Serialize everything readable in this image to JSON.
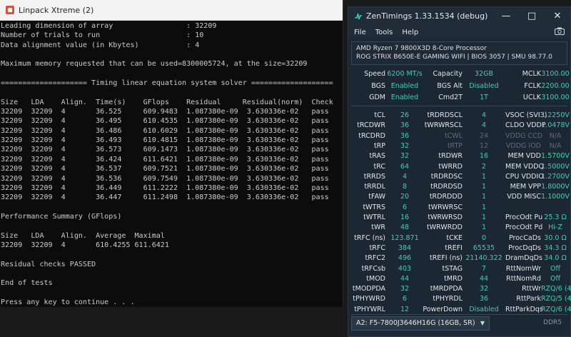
{
  "linpack": {
    "title": "Linpack Xtreme (2)",
    "lines": [
      "Leading dimension of array                 : 32209",
      "Number of trials to run                    : 10",
      "Data alignment value (in Kbytes)           : 4",
      "",
      "Maximum memory requested that can be used=8300005724, at the size=32209",
      "",
      "==================== Timing linear equation system solver ===================",
      "",
      "Size   LDA    Align.  Time(s)    GFlops    Residual     Residual(norm)  Check",
      "32209  32209  4       36.525     609.9483  1.087380e-09  3.630336e-02   pass",
      "32209  32209  4       36.495     610.4535  1.087380e-09  3.630336e-02   pass",
      "32209  32209  4       36.486     610.6029  1.087380e-09  3.630336e-02   pass",
      "32209  32209  4       36.493     610.4815  1.087380e-09  3.630336e-02   pass",
      "32209  32209  4       36.573     609.1473  1.087380e-09  3.630336e-02   pass",
      "32209  32209  4       36.424     611.6421  1.087380e-09  3.630336e-02   pass",
      "32209  32209  4       36.537     609.7521  1.087380e-09  3.630336e-02   pass",
      "32209  32209  4       36.536     609.7549  1.087380e-09  3.630336e-02   pass",
      "32209  32209  4       36.449     611.2222  1.087380e-09  3.630336e-02   pass",
      "32209  32209  4       36.447     611.2498  1.087380e-09  3.630336e-02   pass",
      "",
      "Performance Summary (GFlops)",
      "",
      "Size   LDA    Align.  Average  Maximal",
      "32209  32209  4       610.4255 611.6421",
      "",
      "Residual checks PASSED",
      "",
      "End of tests",
      "",
      "Press any key to continue . . ."
    ]
  },
  "zentimings": {
    "title": "ZenTimings 1.33.1534 (debug)",
    "menu": [
      "File",
      "Tools",
      "Help"
    ],
    "cpu": "AMD Ryzen 7 9800X3D 8-Core Processor",
    "board": "ROG STRIX B650E-E GAMING WIFI | BIOS 3057 | SMU 98.77.0",
    "top_rows": [
      [
        [
          "Speed",
          "6200 MT/s"
        ],
        [
          "Capacity",
          "32GB"
        ],
        [
          "MCLK",
          "3100.00"
        ]
      ],
      [
        [
          "BGS",
          "Enabled"
        ],
        [
          "BGS Alt",
          "Disabled"
        ],
        [
          "FCLK",
          "2200.00"
        ]
      ],
      [
        [
          "GDM",
          "Enabled"
        ],
        [
          "Cmd2T",
          "1T"
        ],
        [
          "UCLK",
          "3100.00"
        ]
      ]
    ],
    "timing_rows": [
      [
        [
          "tCL",
          "26"
        ],
        [
          "tRDRDSCL",
          "4"
        ],
        [
          "VSOC (SVI3)",
          "1.2250V"
        ]
      ],
      [
        [
          "tRCDWR",
          "36"
        ],
        [
          "tWRWRSCL",
          "4"
        ],
        [
          "CLDO VDDP",
          "1.0478V"
        ]
      ],
      [
        [
          "tRCDRD",
          "36"
        ],
        [
          "tCWL",
          "24"
        ],
        [
          "VDDG CCD",
          "N/A"
        ]
      ],
      [
        [
          "tRP",
          "32"
        ],
        [
          "tRTP",
          "12"
        ],
        [
          "VDDG IOD",
          "N/A"
        ]
      ],
      [
        [
          "tRAS",
          "32"
        ],
        [
          "tRDWR",
          "16"
        ],
        [
          "MEM VDD",
          "1.5700V"
        ]
      ],
      [
        [
          "tRC",
          "64"
        ],
        [
          "tWRRD",
          "2"
        ],
        [
          "MEM VDDQ",
          "1.5000V"
        ]
      ],
      [
        [
          "tRRDS",
          "4"
        ],
        [
          "tRDRDSC",
          "1"
        ],
        [
          "CPU VDDIO",
          "1.2700V"
        ]
      ],
      [
        [
          "tRRDL",
          "8"
        ],
        [
          "tRDRDSD",
          "1"
        ],
        [
          "MEM VPP",
          "1.8000V"
        ]
      ],
      [
        [
          "tFAW",
          "20"
        ],
        [
          "tRDRDDD",
          "1"
        ],
        [
          "VDD MISC",
          "1.1000V"
        ]
      ],
      [
        [
          "tWTRS",
          "6"
        ],
        [
          "tWRWRSC",
          "1"
        ],
        [
          "",
          ""
        ]
      ],
      [
        [
          "tWTRL",
          "16"
        ],
        [
          "tWRWRSD",
          "1"
        ],
        [
          "ProcOdt Pu",
          "25.3 Ω"
        ]
      ],
      [
        [
          "tWR",
          "48"
        ],
        [
          "tWRWRDD",
          "1"
        ],
        [
          "ProcOdt Pd",
          "Hi-Z"
        ]
      ],
      [
        [
          "tRFC (ns)",
          "123.871"
        ],
        [
          "tCKE",
          "0"
        ],
        [
          "ProcCaDs",
          "30.0 Ω"
        ]
      ],
      [
        [
          "tRFC",
          "384"
        ],
        [
          "tREFI",
          "65535"
        ],
        [
          "ProcDqDs",
          "34.3 Ω"
        ]
      ],
      [
        [
          "tRFC2",
          "496"
        ],
        [
          "tREFI (ns)",
          "21140.322"
        ],
        [
          "DramDqDs",
          "34.0 Ω"
        ]
      ],
      [
        [
          "tRFCsb",
          "403"
        ],
        [
          "tSTAG",
          "7"
        ],
        [
          "RttNomWr",
          "Off"
        ]
      ],
      [
        [
          "tMOD",
          "44"
        ],
        [
          "tMRD",
          "44"
        ],
        [
          "RttNomRd",
          "Off"
        ]
      ],
      [
        [
          "tMODPDA",
          "32"
        ],
        [
          "tMRDPDA",
          "32"
        ],
        [
          "RttWr",
          "RZQ/6 (40)"
        ]
      ],
      [
        [
          "tPHYWRD",
          "6"
        ],
        [
          "tPHYRDL",
          "36"
        ],
        [
          "RttPark",
          "RZQ/5 (48)"
        ]
      ],
      [
        [
          "tPHYWRL",
          "12"
        ],
        [
          "PowerDown",
          "Disabled"
        ],
        [
          "RttParkDqs",
          "RZQ/6 (40)"
        ]
      ]
    ],
    "dimm_selected": "A2: F5-7800J3646H16G (16GB, SR)",
    "ddr_label": "DDR5",
    "dim_values": [
      "24",
      "12",
      "N/A"
    ],
    "colors": {
      "accent": "#3ad0b5",
      "background": "#1b2733",
      "dim": "#5d6d78"
    }
  }
}
